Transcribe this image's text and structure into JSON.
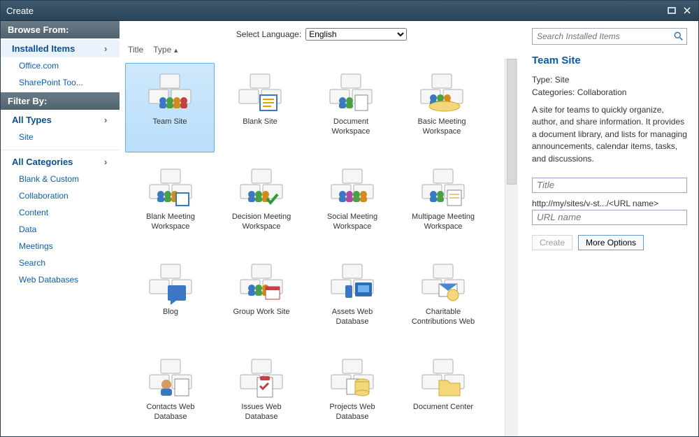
{
  "titlebar": {
    "title": "Create"
  },
  "sidebar": {
    "browse_header": "Browse From:",
    "filter_header": "Filter By:",
    "browse": [
      {
        "label": "Installed Items",
        "major": true,
        "chev": true,
        "sel": true
      },
      {
        "label": "Office.com",
        "minor": true
      },
      {
        "label": "SharePoint Too...",
        "minor": true
      }
    ],
    "types": [
      {
        "label": "All Types",
        "major": true,
        "chev": true
      },
      {
        "label": "Site",
        "minor": true
      }
    ],
    "cats": [
      {
        "label": "All Categories",
        "major": true,
        "chev": true
      },
      {
        "label": "Blank & Custom",
        "minor": true
      },
      {
        "label": "Collaboration",
        "minor": true
      },
      {
        "label": "Content",
        "minor": true
      },
      {
        "label": "Data",
        "minor": true
      },
      {
        "label": "Meetings",
        "minor": true
      },
      {
        "label": "Search",
        "minor": true
      },
      {
        "label": "Web Databases",
        "minor": true
      }
    ]
  },
  "lang": {
    "label": "Select Language:",
    "value": "English"
  },
  "cols": {
    "title": "Title",
    "type": "Type"
  },
  "tiles": [
    {
      "label": "Team Site",
      "icon": "team",
      "sel": true
    },
    {
      "label": "Blank Site",
      "icon": "blank"
    },
    {
      "label": "Document\nWorkspace",
      "icon": "doc-ws"
    },
    {
      "label": "Basic Meeting\nWorkspace",
      "icon": "basic-mtg"
    },
    {
      "label": "Blank Meeting\nWorkspace",
      "icon": "blank-mtg"
    },
    {
      "label": "Decision Meeting\nWorkspace",
      "icon": "dec-mtg"
    },
    {
      "label": "Social Meeting\nWorkspace",
      "icon": "soc-mtg"
    },
    {
      "label": "Multipage Meeting\nWorkspace",
      "icon": "multi-mtg"
    },
    {
      "label": "Blog",
      "icon": "blog"
    },
    {
      "label": "Group Work Site",
      "icon": "group"
    },
    {
      "label": "Assets Web\nDatabase",
      "icon": "assets"
    },
    {
      "label": "Charitable\nContributions Web",
      "icon": "char"
    },
    {
      "label": "Contacts Web\nDatabase",
      "icon": "contacts"
    },
    {
      "label": "Issues Web\nDatabase",
      "icon": "issues"
    },
    {
      "label": "Projects Web\nDatabase",
      "icon": "projects"
    },
    {
      "label": "Document Center",
      "icon": "doc-ctr"
    }
  ],
  "search": {
    "placeholder": "Search Installed Items"
  },
  "details": {
    "title": "Team Site",
    "type_label": "Type:",
    "type_value": "Site",
    "cat_label": "Categories:",
    "cat_value": "Collaboration",
    "desc": "A site for teams to quickly organize, author, and share information. It provides a document library, and lists for managing announcements, calendar items, tasks, and discussions.",
    "title_ph": "Title",
    "url_prefix": "http://my/sites/v-st.../<URL name>",
    "url_ph": "URL name",
    "btn_create": "Create",
    "btn_more": "More Options"
  }
}
